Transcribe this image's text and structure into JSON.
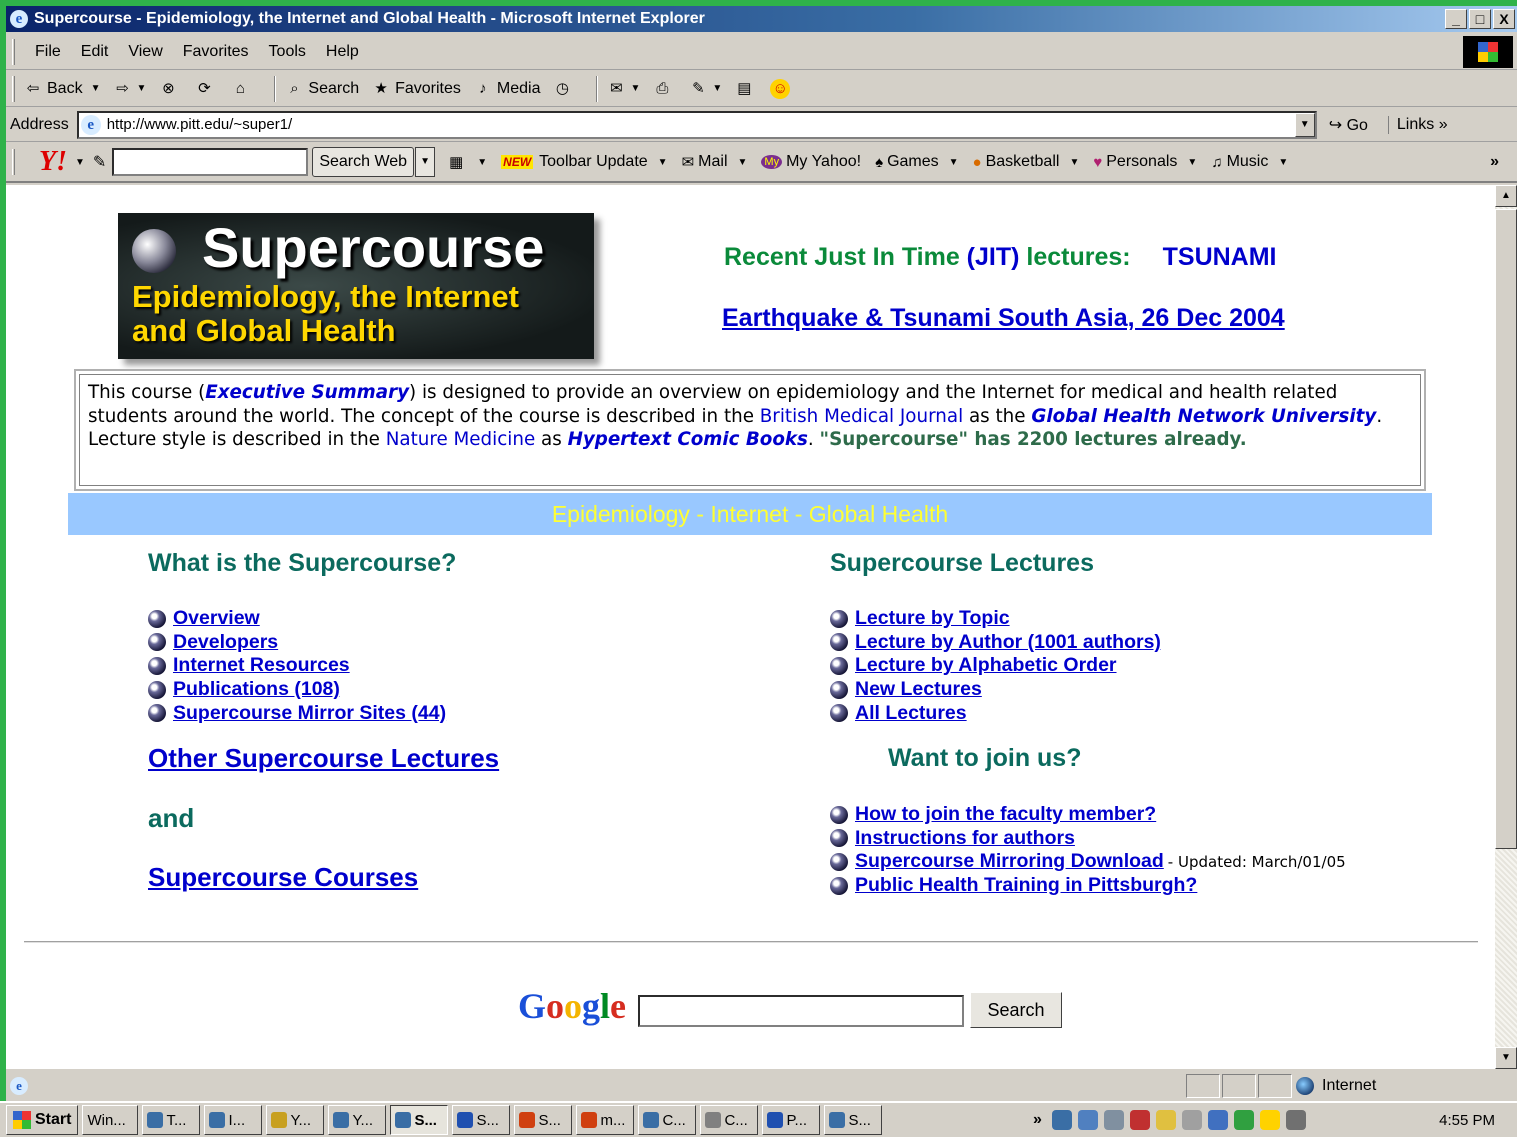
{
  "window": {
    "title": "Supercourse - Epidemiology, the Internet and Global Health - Microsoft Internet Explorer",
    "min": "_",
    "max": "□",
    "close": "X"
  },
  "menu": [
    "File",
    "Edit",
    "View",
    "Favorites",
    "Tools",
    "Help"
  ],
  "toolbar": {
    "back": "Back",
    "search": "Search",
    "favorites": "Favorites",
    "media": "Media"
  },
  "address": {
    "label": "Address",
    "url": "http://www.pitt.edu/~super1/",
    "go": "Go",
    "links": "Links"
  },
  "yahoo": {
    "logo": "Y!",
    "search_btn": "Search Web",
    "new_tag": "NEW",
    "items": [
      "Toolbar Update",
      "Mail",
      "My Yahoo!",
      "Games",
      "Basketball",
      "Personals",
      "Music"
    ],
    "more": "»"
  },
  "page": {
    "logo": {
      "line1": "Supercourse",
      "line2": "Epidemiology, the Internet",
      "line3": "and Global Health"
    },
    "jit": {
      "prefix": "Recent Just In Time ",
      "jit_link": "(JIT)",
      "suffix": " lectures:",
      "tsunami": "TSUNAMI"
    },
    "quake": "Earthquake & Tsunami South Asia, 26 Dec 2004",
    "intro": {
      "t1": "This course (",
      "exec": "Executive Summary",
      "t2": ") is designed to provide an overview on epidemiology and the Internet for medical and health related students around the world. The concept of the course is described in the ",
      "bmj": "British Medical Journal",
      "t3": " as the ",
      "ghnu": "Global Health Network University",
      "t4": ". Lecture style is described in the ",
      "nm": "Nature Medicine",
      "t5": " as ",
      "hcb": "Hypertext Comic Books",
      "t6": ". ",
      "count": "\"Supercourse\" has 2200 lectures already."
    },
    "band": "Epidemiology - Internet - Global Health",
    "left": {
      "heading": "What is the Supercourse?",
      "items": [
        "Overview",
        "Developers",
        "Internet Resources",
        "Publications (108)",
        "Supercourse Mirror Sites (44)"
      ],
      "other": "Other Supercourse Lectures",
      "and": "and",
      "courses": "Supercourse Courses"
    },
    "right": {
      "heading": "Supercourse Lectures",
      "items": [
        "Lecture by Topic",
        "Lecture by Author (1001 authors)",
        "Lecture by Alphabetic Order",
        "New Lectures",
        "All Lectures"
      ],
      "join_heading": "Want to join us?",
      "join_items": [
        "How to join the faculty member?",
        "Instructions for authors",
        "Supercourse Mirroring Download ",
        "Public Health Training in Pittsburgh?"
      ],
      "updated": "- Updated: March/01/05"
    },
    "google": {
      "logo": [
        "G",
        "o",
        "o",
        "g",
        "l",
        "e"
      ],
      "search_btn": "Search"
    }
  },
  "status": {
    "zone": "Internet"
  },
  "taskbar": {
    "start": "Start",
    "tasks": [
      "Win...",
      "T...",
      "I...",
      "Y...",
      "Y...",
      "S...",
      "S...",
      "S...",
      "m...",
      "C...",
      "C...",
      "P...",
      "S..."
    ],
    "more": "»",
    "clock": "4:55 PM"
  }
}
